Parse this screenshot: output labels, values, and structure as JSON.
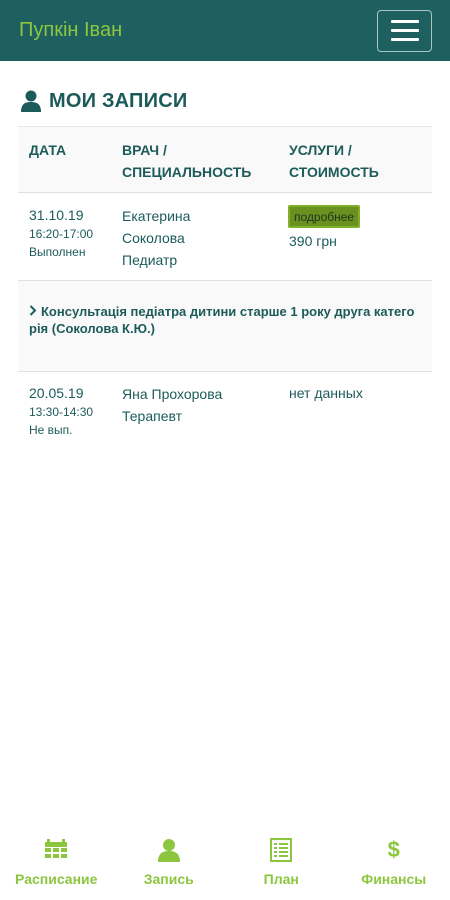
{
  "header": {
    "title": "Пупкін Іван"
  },
  "page": {
    "title": "МОИ ЗАПИСИ"
  },
  "table": {
    "headers": {
      "date": "ДАТА",
      "doctor": "ВРАЧ /\nСПЕЦИАЛЬНОСТЬ",
      "services": "УСЛУГИ /\nСТОИМОСТЬ"
    },
    "rows": [
      {
        "date": "31.10.19",
        "time": "16:20-17:00",
        "status": "Выполнен",
        "doctor_first": "Екатерина",
        "doctor_last": "Соколова",
        "specialty": "Педиатр",
        "details_label": "подробнее",
        "price": "390 грн",
        "detail": "Консультація педіатра дитини старше 1 року друга категорія (Соколова К.Ю.)"
      },
      {
        "date": "20.05.19",
        "time": "13:30-14:30",
        "status": "Не вып.",
        "doctor": "Яна Прохорова",
        "specialty": "Терапевт",
        "services": "нет данных"
      }
    ]
  },
  "nav": {
    "schedule": "Расписание",
    "booking": "Запись",
    "plan": "План",
    "finance": "Финансы",
    "finance_symbol": "$"
  },
  "colors": {
    "header_bg": "#1e6060",
    "accent": "#8cc63f",
    "text": "#1d5b5b",
    "button_bg": "#6b9020"
  }
}
